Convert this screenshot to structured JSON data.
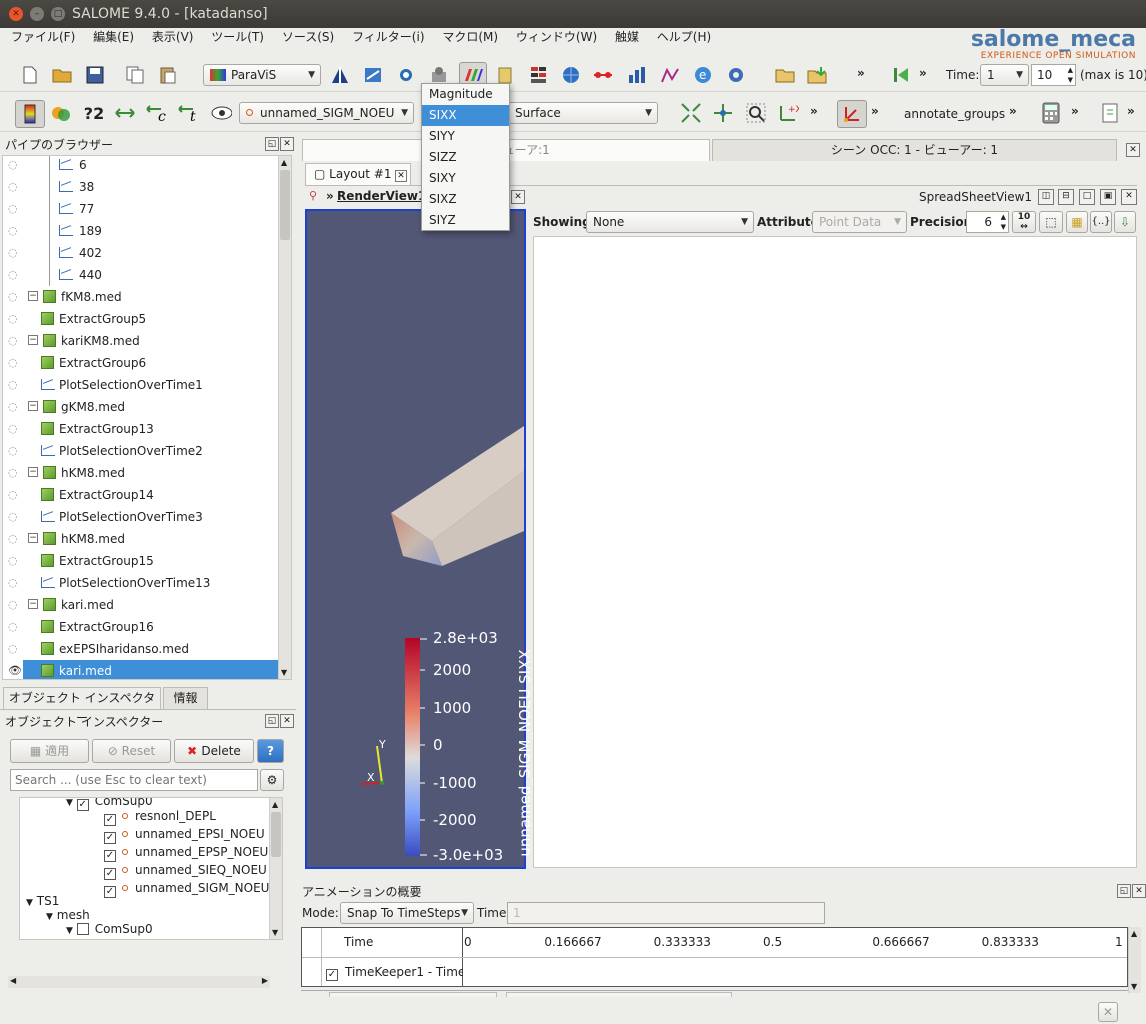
{
  "window": {
    "title": "SALOME 9.4.0 - [katadanso]"
  },
  "menubar": {
    "items": [
      "ファイル(F)",
      "編集(E)",
      "表示(V)",
      "ツール(T)",
      "ソース(S)",
      "フィルター(i)",
      "マクロ(M)",
      "ウィンドウ(W)",
      "触媒",
      "ヘルプ(H)"
    ]
  },
  "logo": {
    "line1": "salome_meca",
    "line2": "EXPERIENCE OPEN SIMULATION"
  },
  "toolbar1": {
    "module": "ParaViS",
    "more1": "»",
    "more2": "»",
    "time_label": "Time:",
    "time_value": "1",
    "time_max": "10",
    "max_text": "(max is 10)"
  },
  "toolbar2": {
    "array_combo": "unnamed_SIGM_NOEU",
    "repr_combo": "Surface",
    "annotate": "annotate_groups",
    "more": "»"
  },
  "dropdown": {
    "items": [
      "Magnitude",
      "SIXX",
      "SIYY",
      "SIZZ",
      "SIXY",
      "SIXZ",
      "SIYZ"
    ],
    "selected": "SIXX"
  },
  "pipeline": {
    "title": "パイプのブラウザー",
    "children_top": [
      "6",
      "38",
      "77",
      "189",
      "402",
      "440"
    ],
    "items": [
      {
        "label": "fKM8.med",
        "kind": "group"
      },
      {
        "label": "ExtractGroup5",
        "kind": "cube"
      },
      {
        "label": "kariKM8.med",
        "kind": "group"
      },
      {
        "label": "ExtractGroup6",
        "kind": "cube"
      },
      {
        "label": "PlotSelectionOverTime1",
        "kind": "plot"
      },
      {
        "label": "gKM8.med",
        "kind": "group"
      },
      {
        "label": "ExtractGroup13",
        "kind": "cube"
      },
      {
        "label": "PlotSelectionOverTime2",
        "kind": "plot"
      },
      {
        "label": "hKM8.med",
        "kind": "group"
      },
      {
        "label": "ExtractGroup14",
        "kind": "cube"
      },
      {
        "label": "PlotSelectionOverTime3",
        "kind": "plot"
      },
      {
        "label": "hKM8.med",
        "kind": "group"
      },
      {
        "label": "ExtractGroup15",
        "kind": "cube"
      },
      {
        "label": "PlotSelectionOverTime13",
        "kind": "plot"
      },
      {
        "label": "kari.med",
        "kind": "group"
      },
      {
        "label": "ExtractGroup16",
        "kind": "cube"
      },
      {
        "label": "exEPSIharidanso.med",
        "kind": "cube"
      },
      {
        "label": "kari.med",
        "kind": "cube"
      }
    ]
  },
  "inspector": {
    "tabs": [
      "オブジェクト インスペクター",
      "情報"
    ],
    "title": "オブジェクト インスペクター",
    "apply": "適用",
    "reset": "Reset",
    "delete": "Delete",
    "help": "?",
    "search_placeholder": "Search ... (use Esc to clear text)",
    "tree": {
      "comsup_top": "ComSup0",
      "fields": [
        "resnonl_DEPL",
        "unnamed_EPSI_NOEU",
        "unnamed_EPSP_NOEU",
        "unnamed_SIEQ_NOEU",
        "unnamed_SIGM_NOEU"
      ],
      "ts": "TS1",
      "mesh": "mesh",
      "comsup": "ComSup0"
    }
  },
  "viewtabs": {
    "left": "シーン ParaView:1 - ビューアー:1",
    "left_visible": "r:1 - ビューア:1",
    "right": "シーン OCC: 1 - ビューアー: 1"
  },
  "layout": {
    "tab": "Layout #1",
    "renderview": "RenderView1",
    "spreadsheetview": "SpreadSheetView1"
  },
  "spreadsheet": {
    "showing_label": "Showing",
    "showing_value": "None",
    "attribute_label": "Attribute:",
    "attribute_value": "Point Data",
    "precision_label": "Precision:",
    "precision_value": "6",
    "prec_btn": "10"
  },
  "colorbar": {
    "title": "unnamed_SIGM_NOEU SIXX",
    "labels": [
      "2.8e+03",
      "2000",
      "1000",
      "0",
      "-1000",
      "-2000",
      "-3.0e+03"
    ]
  },
  "axes": {
    "y": "Y",
    "x": "X"
  },
  "animation": {
    "title": "アニメーションの概要",
    "mode_label": "Mode:",
    "mode_value": "Snap To TimeSteps",
    "time_label": "Time",
    "time_value": "1",
    "header": "Time",
    "ticks": [
      "0",
      "0.166667",
      "0.333333",
      "0.5",
      "0.666667",
      "0.833333",
      "1"
    ],
    "track": "TimeKeeper1 - Time"
  },
  "colors": {
    "accent": "#3f8fd8",
    "render_bg": "#535776",
    "render_border": "#1c3fd6"
  }
}
